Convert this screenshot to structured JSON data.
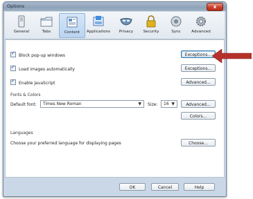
{
  "window": {
    "title": "Options",
    "close_label": "x"
  },
  "tabs": [
    {
      "label": "General",
      "icon": "switch-icon"
    },
    {
      "label": "Tabs",
      "icon": "folder-tabs-icon"
    },
    {
      "label": "Content",
      "icon": "content-icon",
      "selected": true
    },
    {
      "label": "Applications",
      "icon": "applications-icon"
    },
    {
      "label": "Privacy",
      "icon": "mask-icon"
    },
    {
      "label": "Security",
      "icon": "padlock-icon"
    },
    {
      "label": "Sync",
      "icon": "sync-icon"
    },
    {
      "label": "Advanced",
      "icon": "gear-icon"
    }
  ],
  "content": {
    "block_popups": {
      "label": "Block pop-up windows",
      "checked": true,
      "button": "Exceptions..."
    },
    "load_images": {
      "label": "Load images automatically",
      "checked": true,
      "button": "Exceptions..."
    },
    "javascript": {
      "label": "Enable JavaScript",
      "checked": true,
      "button": "Advanced..."
    },
    "fonts": {
      "section": "Fonts & Colors",
      "default_font_label": "Default font:",
      "default_font_value": "Times New Roman",
      "size_label": "Size:",
      "size_value": "16",
      "advanced_button": "Advanced...",
      "colors_button": "Colors..."
    },
    "languages": {
      "section": "Languages",
      "text": "Choose your preferred language for displaying pages",
      "choose_button": "Choose..."
    }
  },
  "footer": {
    "ok": "OK",
    "cancel": "Cancel",
    "help": "Help"
  },
  "annotation": {
    "arrow_color": "#b5322b"
  }
}
